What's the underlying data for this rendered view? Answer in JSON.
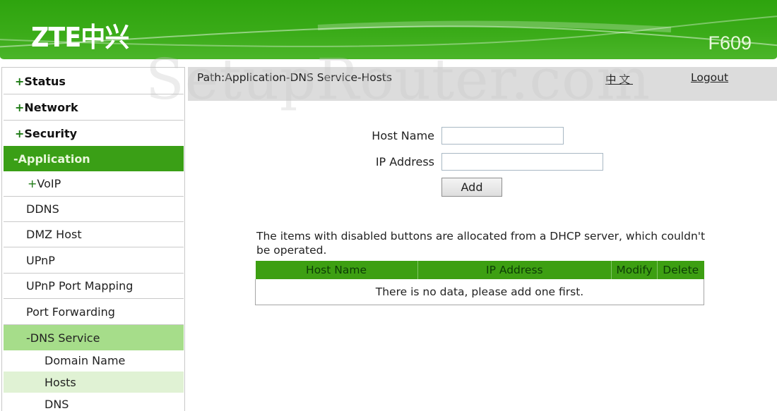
{
  "header": {
    "logo": "ZTE中兴",
    "model": "F609",
    "brand_color": "#3aab18"
  },
  "sidebar": {
    "items": [
      {
        "prefix": "+",
        "label": "Status",
        "level": "top",
        "state": "collapsed"
      },
      {
        "prefix": "+",
        "label": "Network",
        "level": "top",
        "state": "collapsed"
      },
      {
        "prefix": "+",
        "label": "Security",
        "level": "top",
        "state": "collapsed"
      },
      {
        "prefix": "-",
        "label": "Application",
        "level": "top",
        "state": "expanded-active"
      },
      {
        "prefix": "+",
        "label": "VoIP",
        "level": "sub",
        "state": "collapsed"
      },
      {
        "prefix": "",
        "label": "DDNS",
        "level": "sub"
      },
      {
        "prefix": "",
        "label": "DMZ Host",
        "level": "sub"
      },
      {
        "prefix": "",
        "label": "UPnP",
        "level": "sub"
      },
      {
        "prefix": "",
        "label": "UPnP Port Mapping",
        "level": "sub"
      },
      {
        "prefix": "",
        "label": "Port Forwarding",
        "level": "sub"
      },
      {
        "prefix": "-",
        "label": "DNS Service",
        "level": "sub",
        "state": "expanded-active"
      },
      {
        "prefix": "",
        "label": "Domain Name",
        "level": "leaf"
      },
      {
        "prefix": "",
        "label": "Hosts",
        "level": "leaf",
        "state": "selected"
      },
      {
        "prefix": "",
        "label": "DNS",
        "level": "leaf"
      }
    ]
  },
  "pathbar": {
    "path": "Path:Application-DNS Service-Hosts",
    "language_link": "中文",
    "logout_link": "Logout"
  },
  "watermark": "SetupRouter.com",
  "form": {
    "host_name_label": "Host Name",
    "host_name_value": "",
    "ip_address_label": "IP Address",
    "ip_address_value": "",
    "add_button": "Add"
  },
  "note": "The items with disabled buttons are allocated from a DHCP server, which couldn't be operated.",
  "table": {
    "columns": [
      "Host Name",
      "IP Address",
      "Modify",
      "Delete"
    ],
    "rows": [],
    "empty_message": "There is no data, please add one first.",
    "header_color": "#3d9f12"
  }
}
